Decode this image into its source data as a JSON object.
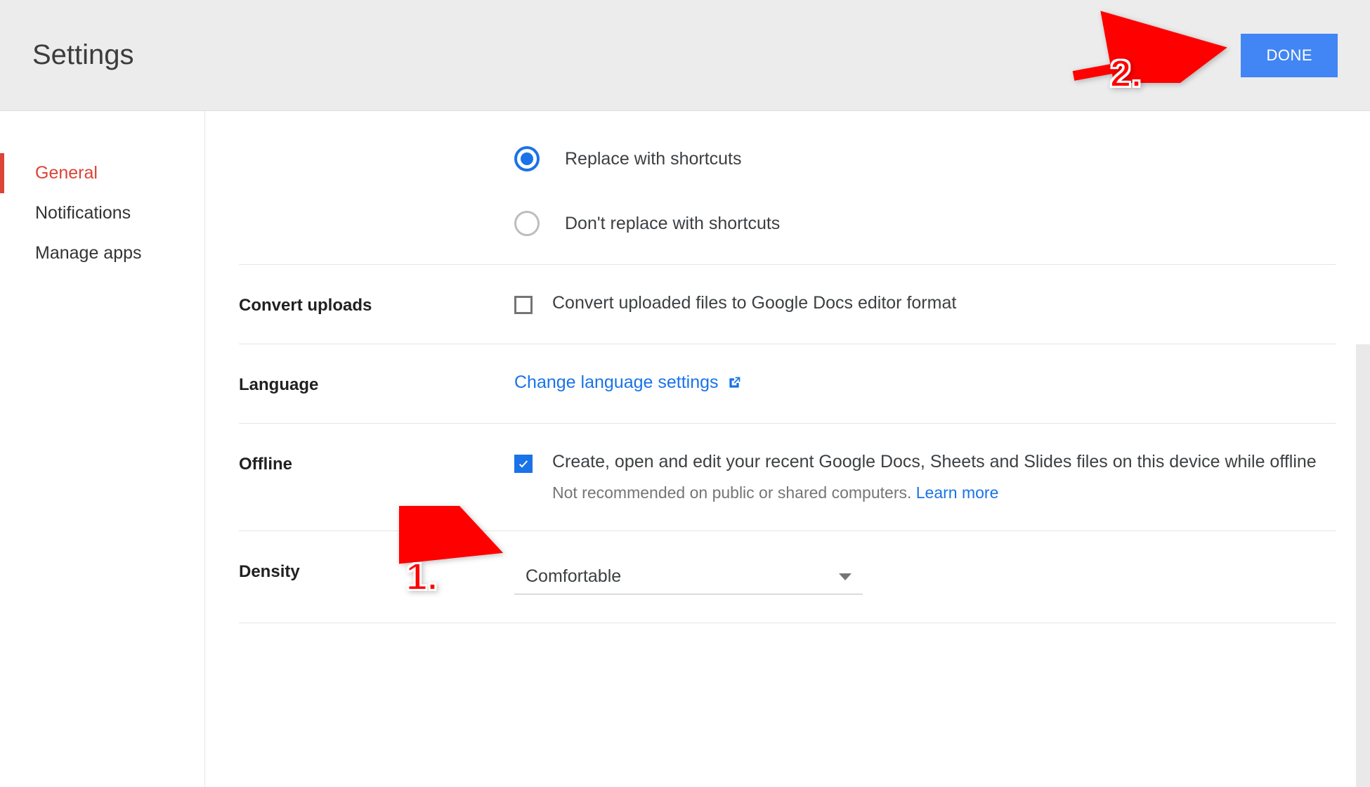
{
  "header": {
    "title": "Settings",
    "done_label": "DONE"
  },
  "sidebar": {
    "items": [
      {
        "label": "General",
        "active": true
      },
      {
        "label": "Notifications",
        "active": false
      },
      {
        "label": "Manage apps",
        "active": false
      }
    ]
  },
  "sections": {
    "shortcuts": {
      "option_selected": "Replace with shortcuts",
      "option_unselected": "Don't replace with shortcuts"
    },
    "convert_uploads": {
      "label": "Convert uploads",
      "checkbox_label": "Convert uploaded files to Google Docs editor format",
      "checked": false
    },
    "language": {
      "label": "Language",
      "link_text": "Change language settings"
    },
    "offline": {
      "label": "Offline",
      "checkbox_label": "Create, open and edit your recent Google Docs, Sheets and Slides files on this device while offline",
      "checked": true,
      "hint": "Not recommended on public or shared computers. ",
      "learn_more": "Learn more"
    },
    "density": {
      "label": "Density",
      "selected": "Comfortable"
    }
  },
  "annotations": {
    "step1": "1.",
    "step2": "2."
  }
}
